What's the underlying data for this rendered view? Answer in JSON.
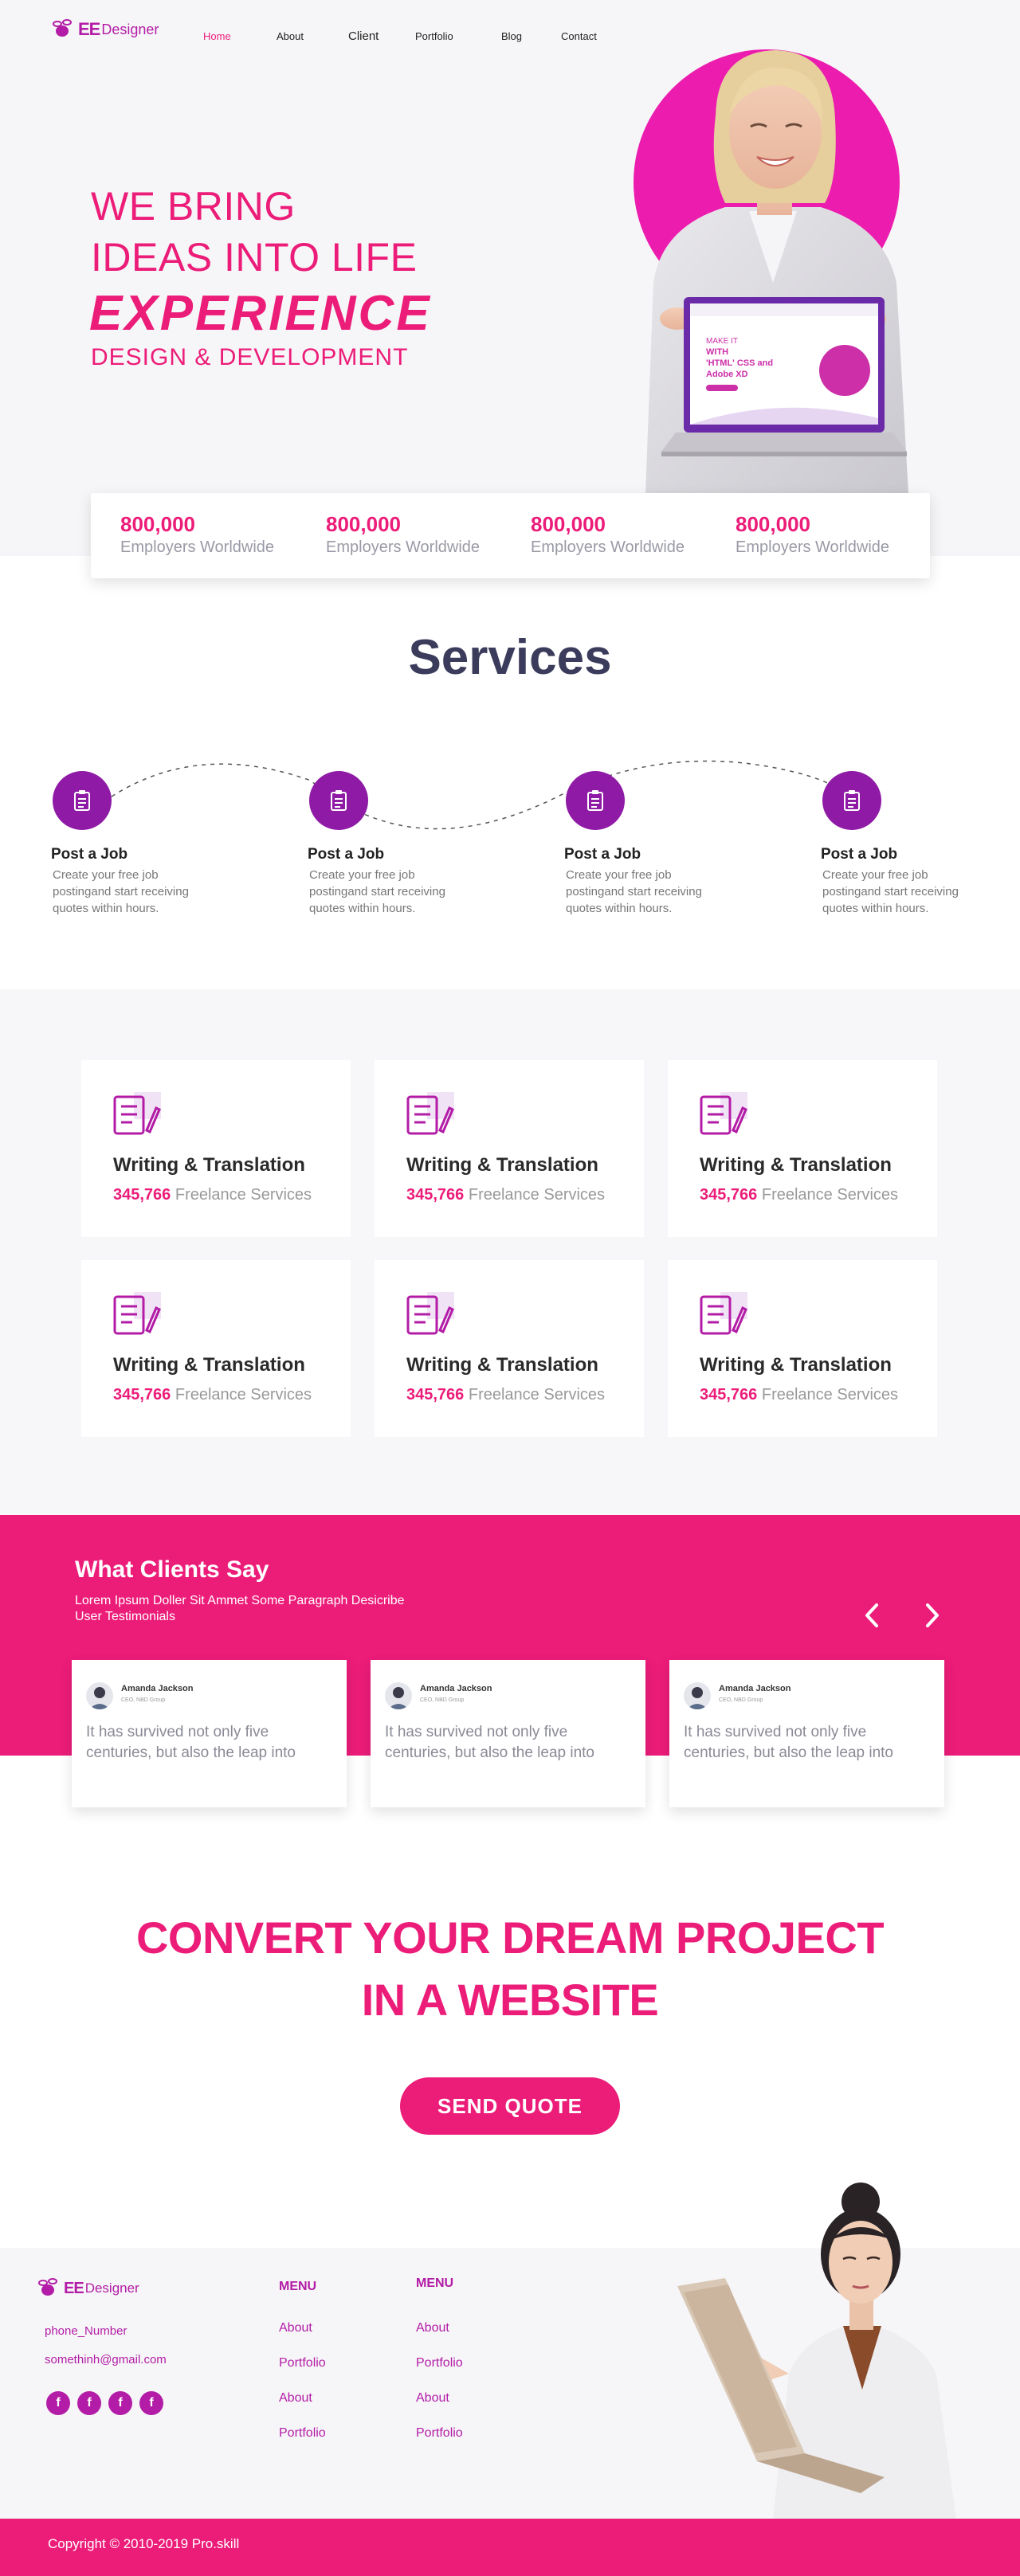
{
  "brand": {
    "ee": "EE",
    "designer": "Designer"
  },
  "nav": {
    "items": [
      "Home",
      "About",
      "Client",
      "Portfolio",
      "Blog",
      "Contact"
    ],
    "active": "Home"
  },
  "hero": {
    "line1": "WE BRING",
    "line2": "IDEAS INTO LIFE",
    "line3": "EXPERIENCE",
    "line4": "DESIGN & DEVELOPMENT",
    "laptop_screen": {
      "line1": "MAKE IT",
      "line2": "WITH",
      "line3": "'HTML' CSS and",
      "line4": "Adobe XD"
    }
  },
  "stats": [
    {
      "value": "800,000",
      "label": "Employers Worldwide"
    },
    {
      "value": "800,000",
      "label": "Employers Worldwide"
    },
    {
      "value": "800,000",
      "label": "Employers Worldwide"
    },
    {
      "value": "800,000",
      "label": "Employers Worldwide"
    }
  ],
  "services": {
    "title": "Services",
    "steps": [
      {
        "name": "Post a Job",
        "desc": "Create your free job postingand start receiving quotes within hours."
      },
      {
        "name": "Post a Job",
        "desc": "Create your free job postingand start receiving quotes within hours."
      },
      {
        "name": "Post a Job",
        "desc": "Create your free job postingand start receiving quotes within hours."
      },
      {
        "name": "Post a Job",
        "desc": "Create your free job postingand start receiving quotes within hours."
      }
    ]
  },
  "categories": [
    {
      "title": "Writing & Translation",
      "count": "345,766",
      "suffix": "Freelance Services"
    },
    {
      "title": "Writing & Translation",
      "count": "345,766",
      "suffix": "Freelance Services"
    },
    {
      "title": "Writing & Translation",
      "count": "345,766",
      "suffix": "Freelance Services"
    },
    {
      "title": "Writing & Translation",
      "count": "345,766",
      "suffix": "Freelance Services"
    },
    {
      "title": "Writing & Translation",
      "count": "345,766",
      "suffix": "Freelance Services"
    },
    {
      "title": "Writing & Translation",
      "count": "345,766",
      "suffix": "Freelance Services"
    }
  ],
  "testimonials": {
    "title": "What Clients Say",
    "subtitle": "Lorem Ipsum Doller Sit Ammet Some Paragraph Desicribe User Testimonials",
    "items": [
      {
        "name": "Amanda Jackson",
        "role": "CEO, NBD Group",
        "quote": "It has survived not only five centuries, but also the leap into"
      },
      {
        "name": "Amanda Jackson",
        "role": "CEO, NBD Group",
        "quote": "It has survived not only five centuries, but also the leap into"
      },
      {
        "name": "Amanda Jackson",
        "role": "CEO, NBD Group",
        "quote": "It has survived not only five centuries, but also the leap into"
      }
    ]
  },
  "cta": {
    "line1": "CONVERT YOUR DREAM PROJECT",
    "line2": "IN A WEBSITE",
    "button": "SEND QUOTE"
  },
  "footer": {
    "phone": "phone_Number",
    "email": "somethinh@gmail.com",
    "social": [
      "f",
      "f",
      "f",
      "f"
    ],
    "menus": [
      {
        "title": "MENU",
        "links": [
          "About",
          "Portfolio",
          "About",
          "Portfolio"
        ]
      },
      {
        "title": "MENU",
        "links": [
          "About",
          "Portfolio",
          "About",
          "Portfolio"
        ]
      }
    ],
    "copyright": "Copyright ©  2010-2019 Pro.skill"
  },
  "colors": {
    "accent": "#ec1c79",
    "purple": "#b31ca6",
    "circle": "#ec1cae",
    "dark_text": "#3b3b5c"
  }
}
